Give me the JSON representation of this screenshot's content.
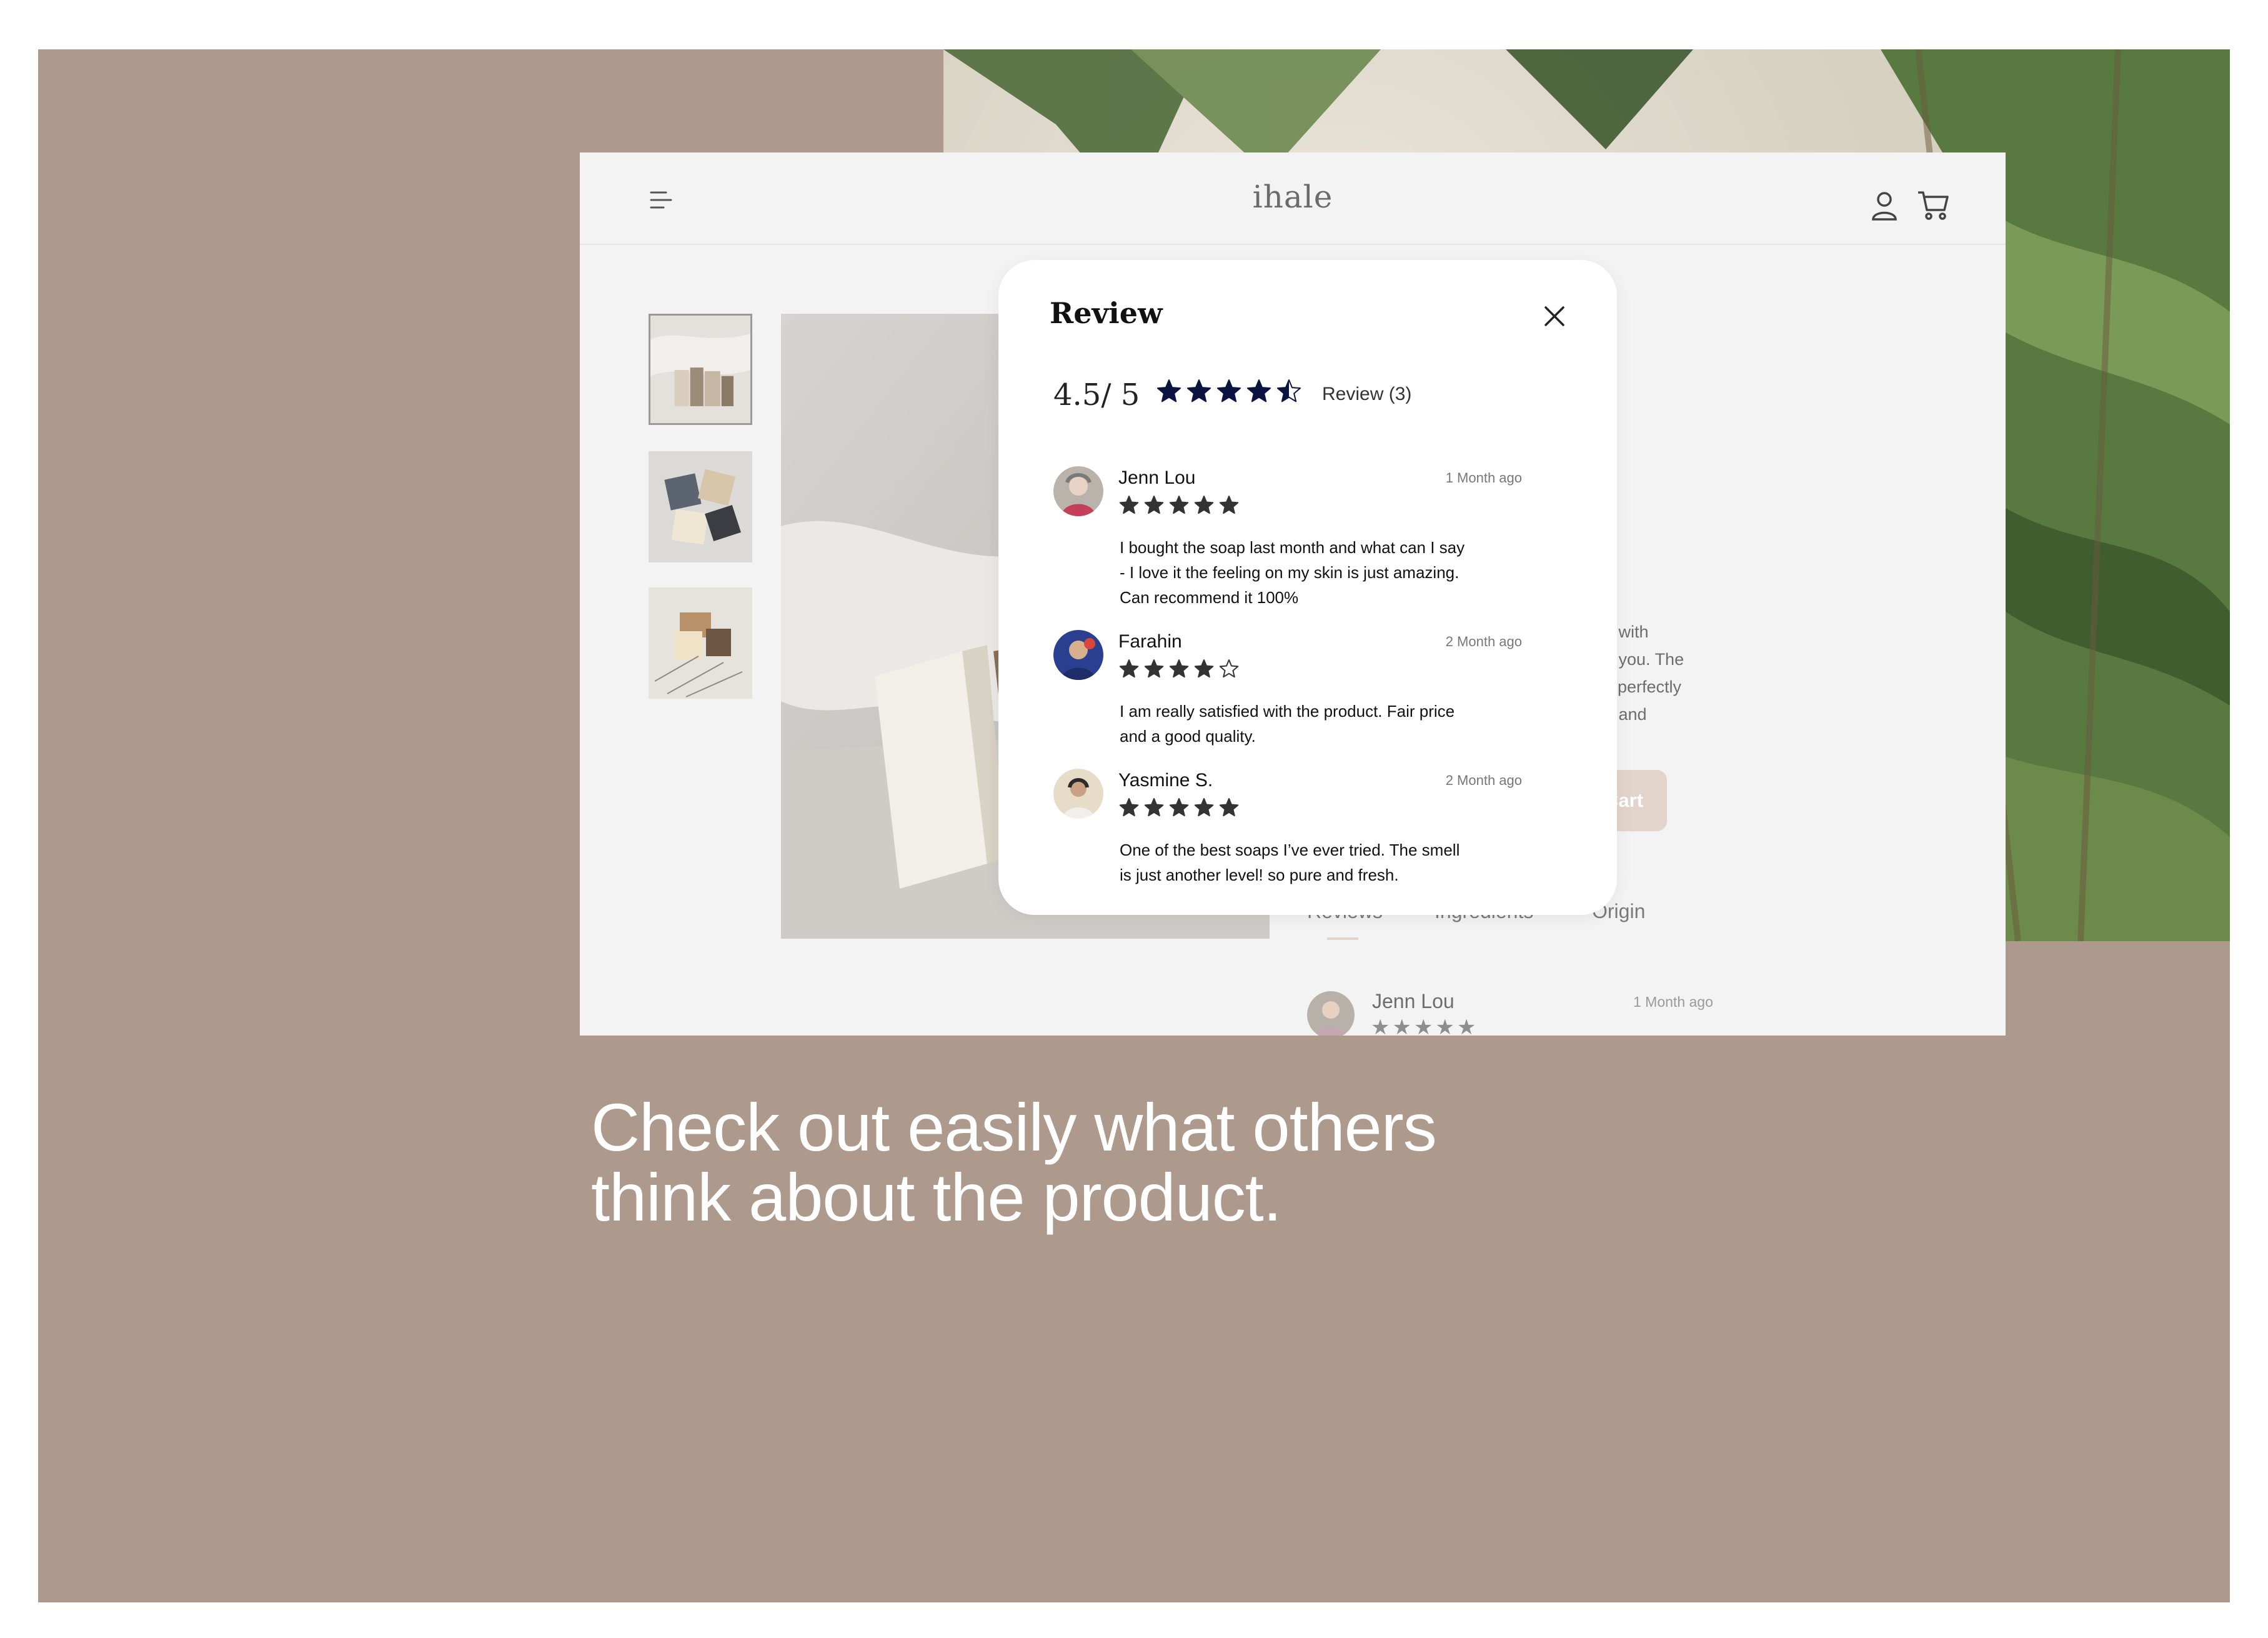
{
  "app": {
    "logo": "ihale"
  },
  "product": {
    "description_fragments": [
      "u with",
      "e you. The",
      "s perfectly",
      "u and"
    ],
    "cart_button_label": "Cart",
    "tabs": [
      {
        "label": "Reviews",
        "active": true
      },
      {
        "label": "Ingredients",
        "active": false
      },
      {
        "label": "Origin",
        "active": false
      }
    ],
    "background_review": {
      "name": "Jenn Lou",
      "time": "1 Month ago",
      "stars": "★★★★★"
    }
  },
  "review_modal": {
    "title": "Review",
    "score": "4.5/ 5",
    "rating": 4.5,
    "count_label": "Review (3)",
    "reviews": [
      {
        "name": "Jenn Lou",
        "time": "1 Month ago",
        "rating": 5,
        "text": "I bought the soap last month and what can I say - I love it the feeling on my skin is just amazing. Can recommend it 100%"
      },
      {
        "name": "Farahin",
        "time": "2 Month ago",
        "rating": 4,
        "text": "I am really satisfied with the product. Fair price and a good quality."
      },
      {
        "name": "Yasmine S.",
        "time": "2 Month ago",
        "rating": 5,
        "text": "One of the best soaps I’ve ever tried. The smell is just another level! so pure and fresh."
      }
    ]
  },
  "caption": {
    "headline": "Check out easily what others think about the product."
  },
  "colors": {
    "backdrop": "#ad9a8c",
    "star": "#0b1340",
    "star_small": "#333333",
    "accent": "#e2d4cb"
  },
  "icons": [
    "menu-icon",
    "user-icon",
    "cart-icon",
    "close-icon",
    "star-icon",
    "half-star-icon",
    "empty-star-icon"
  ]
}
